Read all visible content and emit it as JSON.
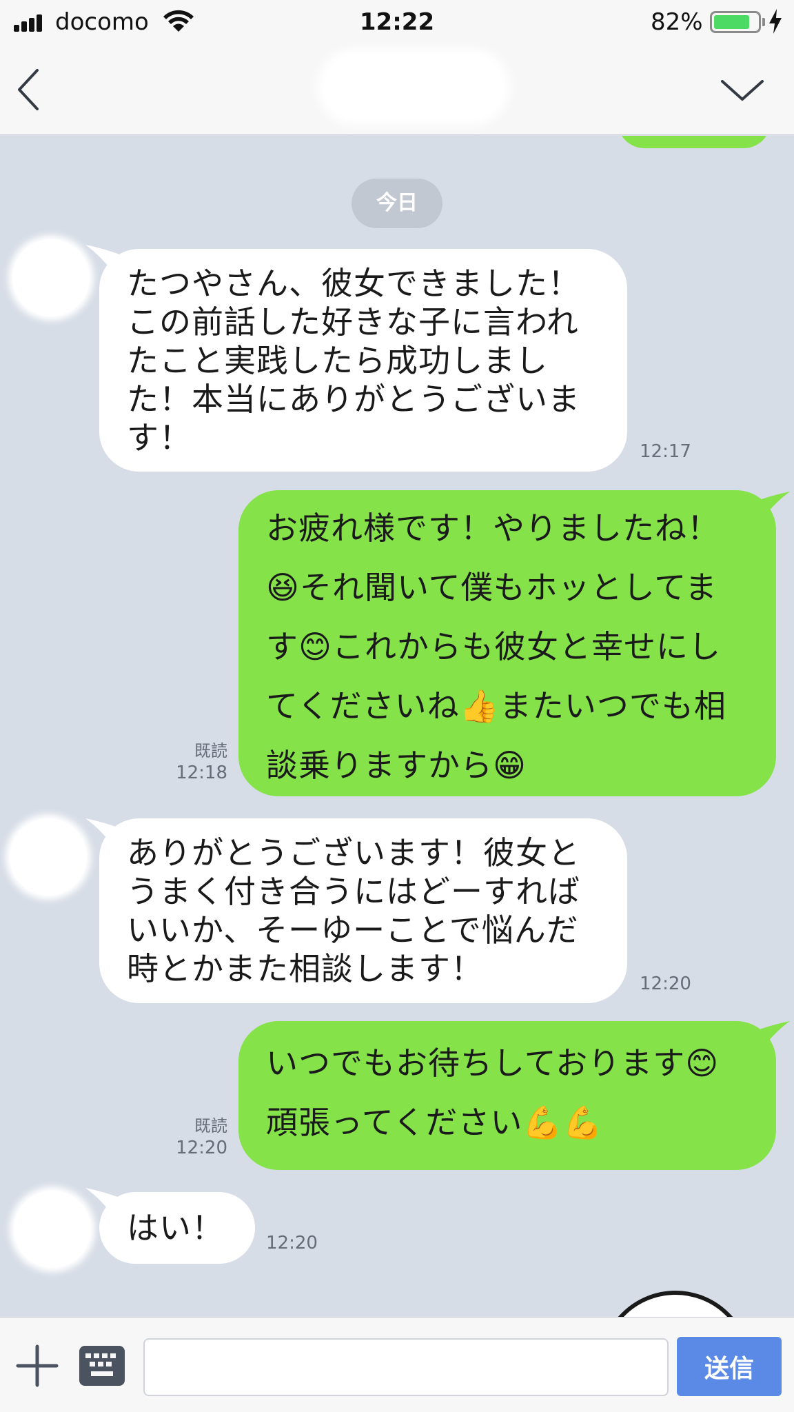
{
  "status_bar": {
    "carrier": "docomo",
    "time": "12:22",
    "battery_percent": "82%",
    "battery_level": 0.82,
    "icons": [
      "signal-icon",
      "wifi-icon",
      "battery-icon",
      "charging-bolt-icon"
    ]
  },
  "nav": {
    "back_icon": "chevron-left-icon",
    "menu_icon": "chevron-down-icon"
  },
  "chat": {
    "date_separator": "今日",
    "messages": [
      {
        "side": "in",
        "text": "たつやさん、彼女できました！\nこの前話した好きな子に言われ\nたこと実践したら成功しまし\nた！本当にありがとうございま\nす！",
        "time": "12:17"
      },
      {
        "side": "out",
        "text": "お疲れ様です！やりましたね！\n😆それ聞いて僕もホッとしてま\nす😊これからも彼女と幸せにし\nてくださいね👍またいつでも相\n談乗りますから😁",
        "read": "既読",
        "time": "12:18"
      },
      {
        "side": "in",
        "text": "ありがとうございます！彼女と\nうまく付き合うにはどーすれば\nいいか、そーゆーことで悩んだ\n時とかまた相談します！",
        "time": "12:20"
      },
      {
        "side": "out",
        "text": "いつでもお待ちしております😊\n頑張ってください💪💪",
        "read": "既読",
        "time": "12:20"
      },
      {
        "side": "in",
        "text": "はい！",
        "time": "12:20"
      }
    ]
  },
  "input_bar": {
    "plus_icon": "plus-icon",
    "keyboard_icon": "keyboard-icon",
    "input_value": "",
    "send_label": "送信",
    "colors": {
      "send": "#5a8ae6",
      "outgoing_bubble": "#85e249",
      "background": "#d7dde7"
    }
  }
}
